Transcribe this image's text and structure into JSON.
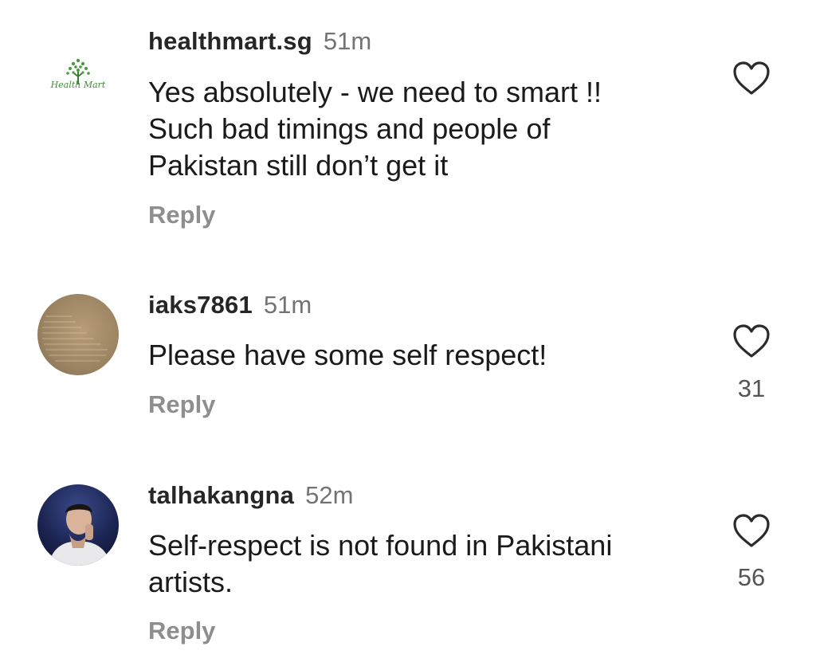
{
  "comments": [
    {
      "username": "healthmart.sg",
      "time": "51m",
      "text": "Yes absolutely - we need to smart !!\nSuch bad timings and people of\nPakistan still  don’t get it",
      "reply_label": "Reply",
      "likes": "",
      "avatar_icon": "healthmart-logo",
      "logo_text": "Health Mart"
    },
    {
      "username": "iaks7861",
      "time": "51m",
      "text": "Please have some self respect!",
      "reply_label": "Reply",
      "likes": "31",
      "avatar_icon": "profile-photo"
    },
    {
      "username": "talhakangna",
      "time": "52m",
      "text": "Self-respect is not found in Pakistani\nartists.",
      "reply_label": "Reply",
      "likes": "56",
      "avatar_icon": "profile-photo"
    }
  ],
  "colors": {
    "username": "#262626",
    "timestamp": "#737373",
    "reply": "#8e8e8e",
    "heart_stroke": "#2b2b2b",
    "logo_green": "#3e8e3a"
  }
}
